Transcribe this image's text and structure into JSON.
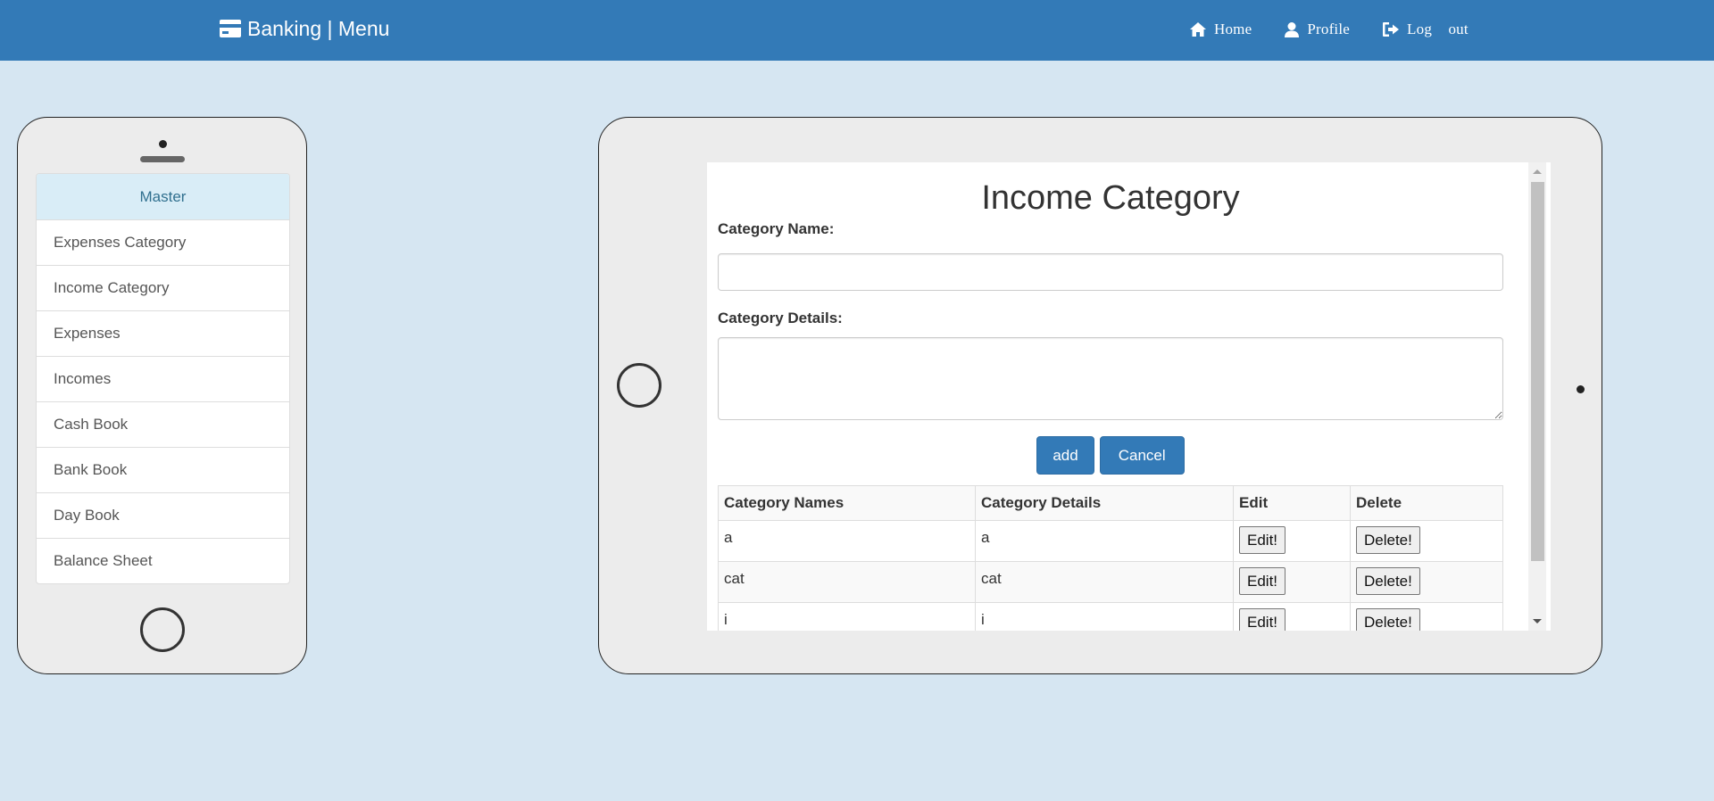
{
  "navbar": {
    "brand": "Banking | Menu",
    "brand_icon": "credit-card-icon",
    "links": [
      {
        "label": "Home",
        "icon": "home-icon"
      },
      {
        "label": "Profile",
        "icon": "user-icon"
      },
      {
        "label": "Log out",
        "icon": "logout-icon"
      }
    ]
  },
  "sidebar": {
    "header": "Master",
    "items": [
      {
        "label": "Expenses Category"
      },
      {
        "label": "Income Category"
      },
      {
        "label": "Expenses"
      },
      {
        "label": "Incomes"
      },
      {
        "label": "Cash Book"
      },
      {
        "label": "Bank Book"
      },
      {
        "label": "Day Book"
      },
      {
        "label": "Balance Sheet"
      }
    ]
  },
  "form": {
    "title": "Income Category",
    "name_label": "Category Name:",
    "name_value": "",
    "details_label": "Category Details:",
    "details_value": "",
    "add_label": "add",
    "cancel_label": "Cancel"
  },
  "table": {
    "headers": [
      "Category Names",
      "Category Details",
      "Edit",
      "Delete"
    ],
    "rows": [
      {
        "name": "a",
        "details": "a",
        "edit": "Edit!",
        "delete": "Delete!"
      },
      {
        "name": "cat",
        "details": "cat",
        "edit": "Edit!",
        "delete": "Delete!"
      },
      {
        "name": "i",
        "details": "i",
        "edit": "Edit!",
        "delete": "Delete!"
      }
    ]
  },
  "colors": {
    "navbar": "#337ab7",
    "background": "#d6e6f2",
    "menu_header": "#d9edf7",
    "primary_button": "#337ab7"
  }
}
